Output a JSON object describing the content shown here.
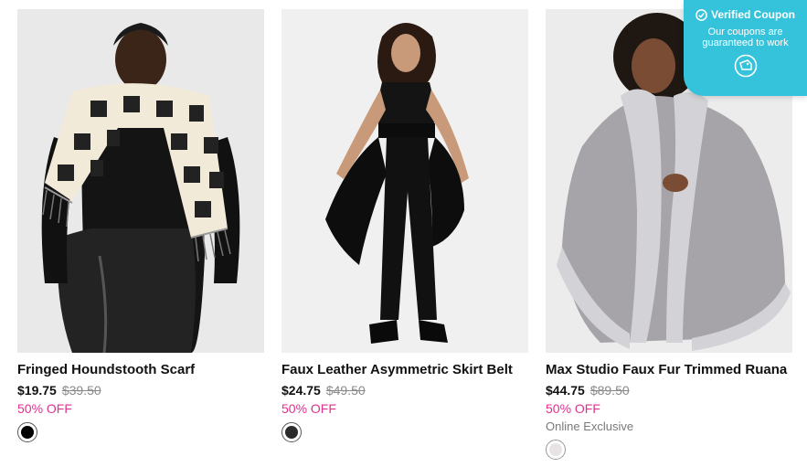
{
  "products": [
    {
      "title": "Fringed Houndstooth Scarf",
      "price": "$19.75",
      "original_price": "$39.50",
      "discount": "50% OFF",
      "note": "",
      "swatch_color": "#000000",
      "image_icon": "model-scarf-image"
    },
    {
      "title": "Faux Leather Asymmetric Skirt Belt",
      "price": "$24.75",
      "original_price": "$49.50",
      "discount": "50% OFF",
      "note": "",
      "swatch_color": "#2b2b2b",
      "image_icon": "model-belt-image"
    },
    {
      "title": "Max Studio Faux Fur Trimmed Ruana",
      "price": "$44.75",
      "original_price": "$89.50",
      "discount": "50% OFF",
      "note": "Online Exclusive",
      "swatch_color": "#e8e2e2",
      "image_icon": "model-ruana-image"
    }
  ],
  "coupon": {
    "title": "Verified Coupon",
    "line1": "Our coupons are",
    "line2": "guaranteed to work",
    "icon": "coupon-chat-icon",
    "check_icon": "check-circle-icon"
  },
  "colors": {
    "discount": "#e0318f",
    "coupon_bg": "#35c3dc"
  }
}
